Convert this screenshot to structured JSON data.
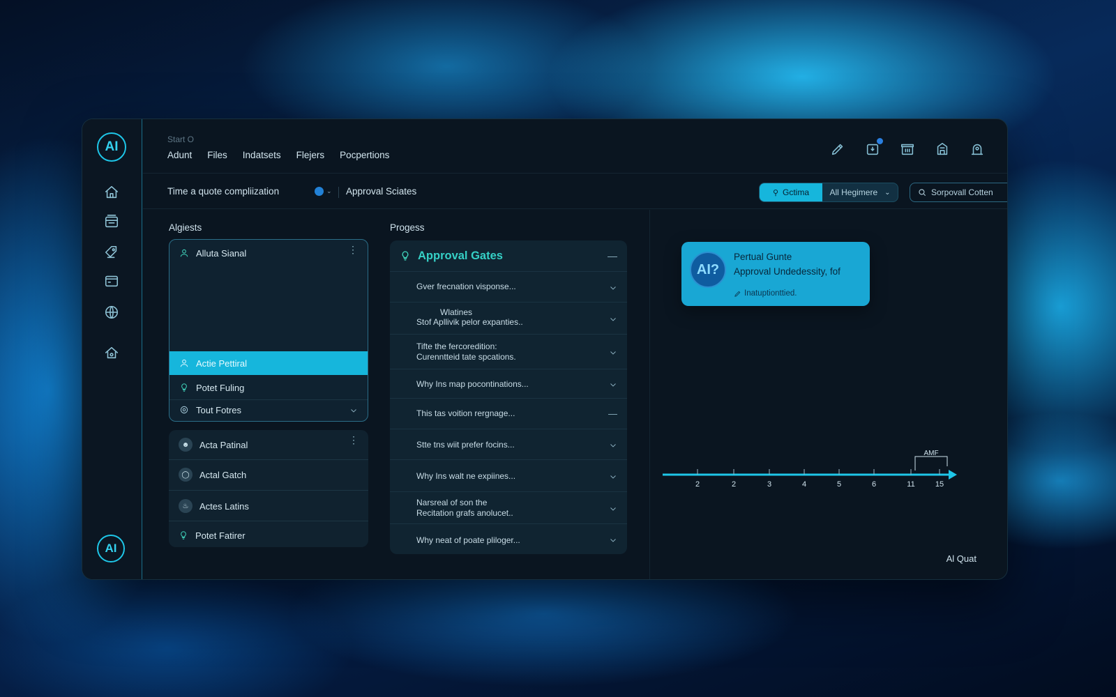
{
  "brand": {
    "logo_text": "AI",
    "footer_logo_text": "AI"
  },
  "header": {
    "breadcrumb": "Start O",
    "nav": [
      "Adunt",
      "Files",
      "Indatsets",
      "Flejers",
      "Pocpertions"
    ],
    "icons": [
      "edit-icon",
      "notification-icon",
      "archive-icon",
      "building-icon",
      "user-icon"
    ]
  },
  "sidebar": {
    "icons": [
      "home-icon",
      "inbox-icon",
      "tag-icon",
      "wallet-icon",
      "globe-icon",
      "house-settings-icon"
    ]
  },
  "filterbar": {
    "title": "Time a quote compliization",
    "status_color": "#2281d6",
    "approval_states": "Approval Sciates",
    "segment_active": "Gctima",
    "segment_other": "All Hegimere",
    "search_value": "Sorpovall Cotten"
  },
  "agents": {
    "title": "Algiests",
    "card1": {
      "header": "Alluta Sianal",
      "items": [
        "Actie Pettiral",
        "Potet Fuling",
        "Tout Fotres"
      ],
      "active_index": 0
    },
    "card2": {
      "items": [
        "Acta Patinal",
        "Actal Gatch",
        "Actes Latins",
        "Potet Fatirer"
      ]
    }
  },
  "progress": {
    "title": "Progess",
    "card_title": "Approval Gates",
    "items": [
      {
        "line1": "Gver frecnation visponse...",
        "line2": ""
      },
      {
        "line1": "Wlatines",
        "line2": "Stof Apllivik pelor expanties.."
      },
      {
        "line1": "Tifte the fercoredition:",
        "line2": "Curenntteid tate spcations."
      },
      {
        "line1": "Why Ins map pocontinations...",
        "line2": ""
      },
      {
        "line1": "This tas voition rergnage...",
        "line2": ""
      },
      {
        "line1": "Stte tns wiit prefer focins...",
        "line2": ""
      },
      {
        "line1": "Why Ins walt ne expiines...",
        "line2": ""
      },
      {
        "line1": "Narsreal of son the",
        "line2": "Recitation grafs anolucet.."
      },
      {
        "line1": "Why neat of poate pliloger...",
        "line2": ""
      }
    ]
  },
  "notification": {
    "logo_text": "AI?",
    "title": "Pertual Gunte",
    "subtitle": "Approval Undedessity, fof",
    "footer": "Inatuptionttied."
  },
  "timeline": {
    "ticks": [
      "2",
      "2",
      "3",
      "4",
      "5",
      "6",
      "11",
      "15"
    ],
    "marker_label": "AMF",
    "accent_color": "#1ec6e8"
  },
  "footer_label": "Al Quat"
}
